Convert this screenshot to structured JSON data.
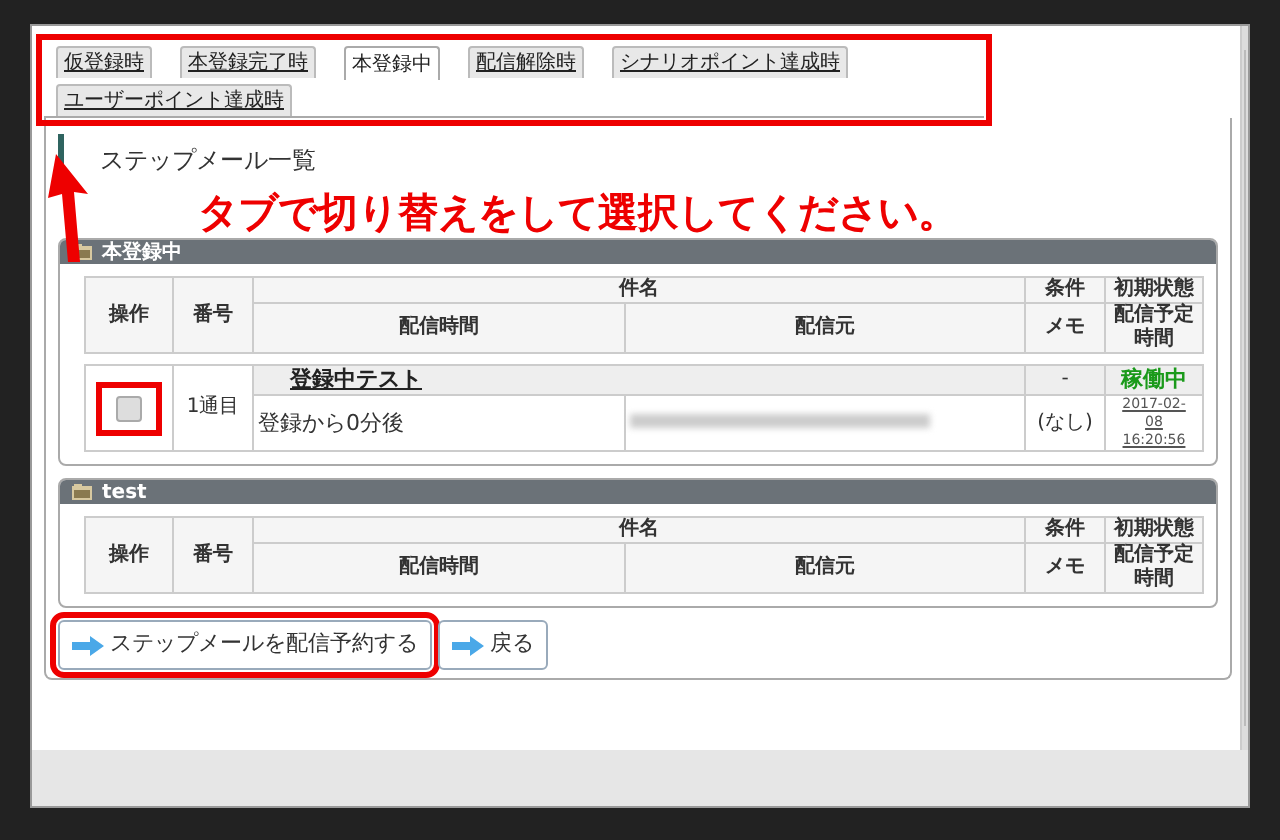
{
  "tabs_highlighted": true,
  "tabs": [
    {
      "label": "仮登録時",
      "selected": false
    },
    {
      "label": "本登録完了時",
      "selected": false
    },
    {
      "label": "本登録中",
      "selected": true
    },
    {
      "label": "配信解除時",
      "selected": false
    },
    {
      "label": "シナリオポイント達成時",
      "selected": false
    },
    {
      "label": "ユーザーポイント達成時",
      "selected": false
    }
  ],
  "page_title": "ステップメール一覧",
  "sections": [
    {
      "title": "本登録中",
      "header_top": [
        "操作",
        "番号",
        "件名",
        "条件",
        "初期状態"
      ],
      "header_bottom": [
        "配信時間",
        "配信元",
        "メモ",
        "配信予定時間"
      ],
      "rows": [
        {
          "checked": false,
          "highlighted": true,
          "number": "1通目",
          "subject": "登録中テスト",
          "condition": "-",
          "status": "稼働中",
          "time": "登録から0分後",
          "memo": "(なし)",
          "scheduled": "2017-02-08 16:20:56"
        }
      ]
    },
    {
      "title": "test",
      "header_top": [
        "操作",
        "番号",
        "件名",
        "条件",
        "初期状態"
      ],
      "header_bottom": [
        "配信時間",
        "配信元",
        "メモ",
        "配信予定時間"
      ]
    }
  ],
  "buttons": [
    {
      "label": "ステップメールを配信予約する",
      "highlighted": true
    },
    {
      "label": "戻る",
      "highlighted": false
    }
  ],
  "callout": "タブで切り替えをして選択してください。"
}
